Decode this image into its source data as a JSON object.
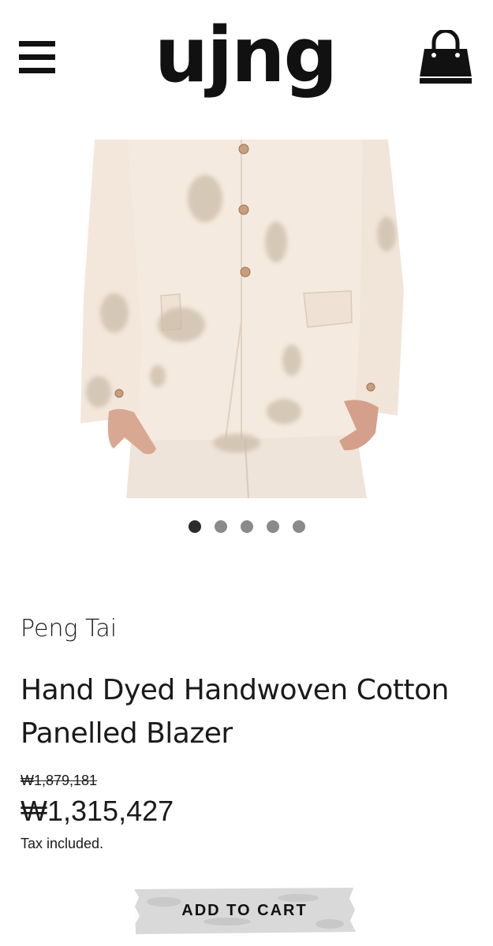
{
  "header": {
    "logo_text": "ujng",
    "menu_icon": "hamburger-menu-icon",
    "cart_icon": "shopping-bag-icon"
  },
  "gallery": {
    "image_alt": "Cream hand dyed blazer with matching trousers",
    "slide_count": 5,
    "active_slide": 1
  },
  "product": {
    "vendor": "Peng Tai",
    "title": "Hand Dyed Handwoven Cotton Panelled Blazer",
    "compare_price": "₩1,879,181",
    "price": "₩1,315,427",
    "tax_note": "Tax included.",
    "add_to_cart_label": "ADD TO CART"
  },
  "colors": {
    "text": "#111111",
    "dot_active": "#2b2b2b",
    "dot_inactive": "#8a8a8a",
    "blazer": "#f3e6da"
  }
}
